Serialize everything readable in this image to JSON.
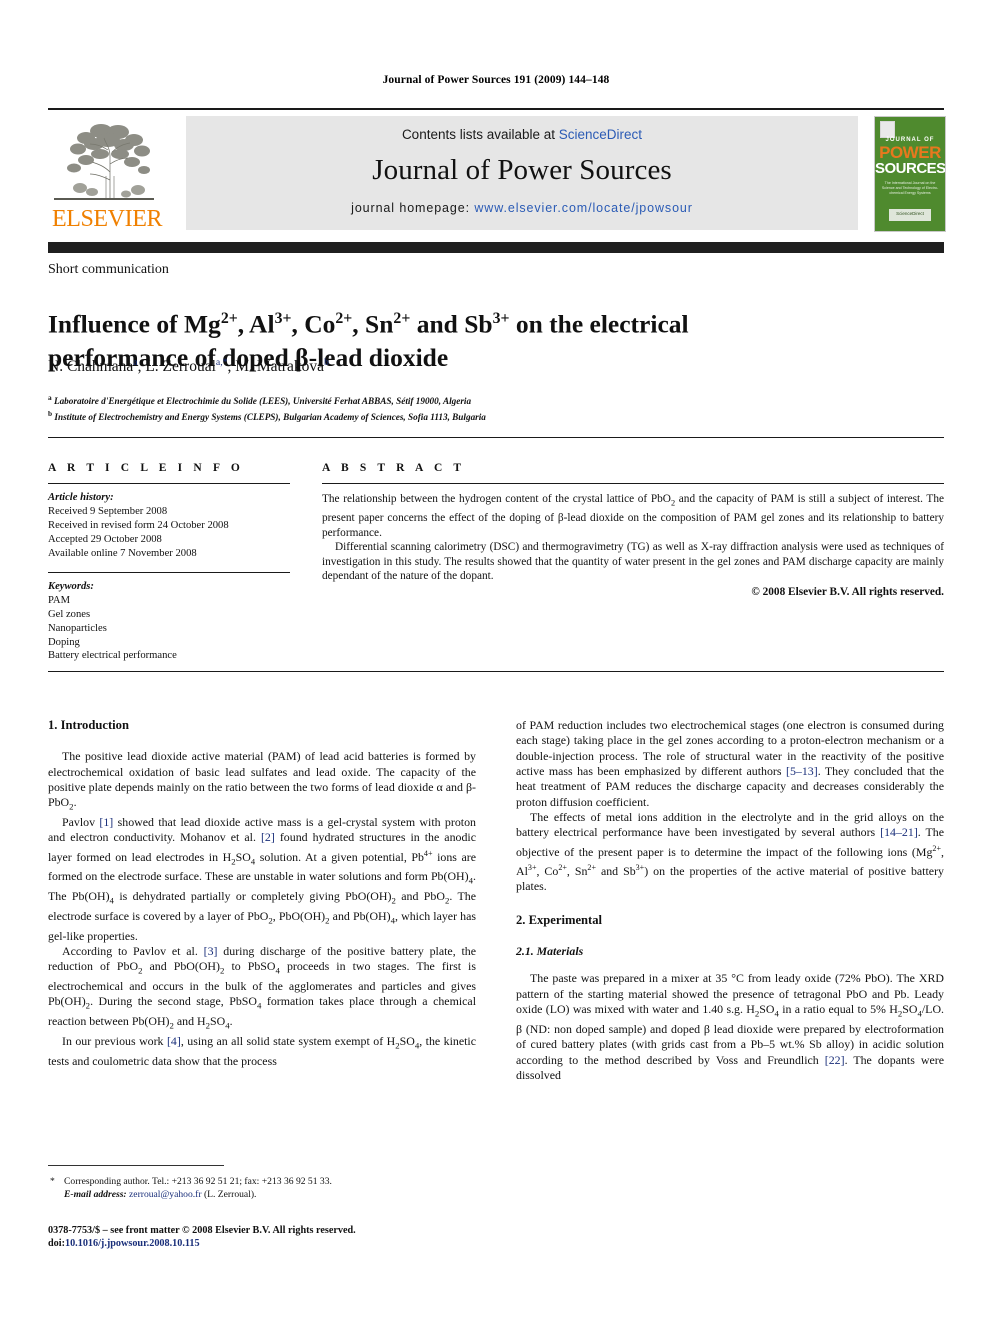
{
  "running_head": "Journal of Power Sources 191 (2009) 144–148",
  "header": {
    "contents_prefix": "Contents lists available at ",
    "sciencedirect": "ScienceDirect",
    "journal_title": "Journal of Power Sources",
    "homepage_label": "journal homepage: ",
    "homepage_url": "www.elsevier.com/locate/jpowsour",
    "publisher_logo_word": "ELSEVIER",
    "accent_orange": "#F08000",
    "link_blue": "#2b5bb5",
    "panel_gray": "#e6e6e6",
    "cover": {
      "line1": "JOURNAL OF",
      "line2": "POWER",
      "line3": "SOURCES",
      "blurb": "The International Journal on the Science and Technology of Electro­chemical Energy Systems",
      "sciencedirect_badge": "ScienceDirect",
      "bg_color": "#4f8a2e"
    }
  },
  "article": {
    "type_label": "Short communication",
    "title_html": "Influence of Mg<sup>2+</sup>, Al<sup>3+</sup>, Co<sup>2+</sup>, Sn<sup>2+</sup> and Sb<sup>3+</sup> on the electrical performance of doped β-lead dioxide",
    "authors_html": "N. Chahmana<sup>a</sup>, L. Zerroual<sup>a,*</sup>, M. Matrakova<sup>b</sup>",
    "affiliations_html": "<sup>a</sup> Laboratoire d'Energétique et Electrochimie du Solide (LEES), Université Ferhat ABBAS, Sétif 19000, Algeria<br><sup>b</sup> Institute of Electrochemistry and Energy Systems (CLEPS), Bulgarian Academy of Sciences, Sofia 1113, Bulgaria"
  },
  "info": {
    "heading": "A R T I C L E   I N F O",
    "history_label": "Article history:",
    "history": [
      "Received 9 September 2008",
      "Received in revised form 24 October 2008",
      "Accepted 29 October 2008",
      "Available online 7 November 2008"
    ],
    "keywords_label": "Keywords:",
    "keywords": [
      "PAM",
      "Gel zones",
      "Nanoparticles",
      "Doping",
      "Battery electrical performance"
    ]
  },
  "abstract": {
    "heading": "A B S T R A C T",
    "para1_html": "The relationship between the hydrogen content of the crystal lattice of PbO<sub>2</sub> and the capacity of PAM is still a subject of interest. The present paper concerns the effect of the doping of β-lead dioxide on the composition of PAM gel zones and its relationship to battery performance.",
    "para2_html": "Differential scanning calorimetry (DSC) and thermogravimetry (TG) as well as X-ray diffraction analysis were used as techniques of investigation in this study. The results showed that the quantity of water present in the gel zones and PAM discharge capacity are mainly dependant of the nature of the dopant.",
    "copyright": "© 2008 Elsevier B.V. All rights reserved."
  },
  "body": {
    "intro_heading": "1. Introduction",
    "left_p1_html": "The positive lead dioxide active material (PAM) of lead acid batteries is formed by electrochemical oxidation of basic lead sulfates and lead oxide. The capacity of the positive plate depends mainly on the ratio between the two forms of lead dioxide α and β-PbO<sub>2</sub>.",
    "left_p2_html": "Pavlov <span class=\"ref\">[1]</span> showed that lead dioxide active mass is a gel-crystal system with proton and electron conductivity. Mohanov et al. <span class=\"ref\">[2]</span> found hydrated structures in the anodic layer formed on lead electrodes in H<sub>2</sub>SO<sub>4</sub> solution. At a given potential, Pb<sup class=\"chg\">4+</sup> ions are formed on the electrode surface. These are unstable in water solutions and form Pb(OH)<sub>4</sub>. The Pb(OH)<sub>4</sub> is dehydrated partially or completely giving PbO(OH)<sub>2</sub> and PbO<sub>2</sub>. The electrode surface is covered by a layer of PbO<sub>2</sub>, PbO(OH)<sub>2</sub> and Pb(OH)<sub>4</sub>, which layer has gel-like properties.",
    "left_p3_html": "According to Pavlov et al. <span class=\"ref\">[3]</span> during discharge of the positive battery plate, the reduction of PbO<sub>2</sub> and PbO(OH)<sub>2</sub> to PbSO<sub>4</sub> proceeds in two stages. The first is electrochemical and occurs in the bulk of the agglomerates and particles and gives Pb(OH)<sub>2</sub>. During the second stage, PbSO<sub>4</sub> formation takes place through a chemical reaction between Pb(OH)<sub>2</sub> and H<sub>2</sub>SO<sub>4</sub>.",
    "left_p4_html": "In our previous work <span class=\"ref\">[4]</span>, using an all solid state system exempt of H<sub>2</sub>SO<sub>4</sub>, the kinetic tests and coulometric data show that the process",
    "right_p1_html": "of PAM reduction includes two electrochemical stages (one electron is consumed during each stage) taking place in the gel zones according to a proton-electron mechanism or a double-injection process. The role of structural water in the reactivity of the positive active mass has been emphasized by different authors <span class=\"ref\">[5–13]</span>. They concluded that the heat treatment of PAM reduces the discharge capacity and decreases considerably the proton diffusion coefficient.",
    "right_p2_html": "The effects of metal ions addition in the electrolyte and in the grid alloys on the battery electrical performance have been investigated by several authors <span class=\"ref\">[14–21]</span>. The objective of the present paper is to determine the impact of the following ions (Mg<sup class=\"chg\">2+</sup>, Al<sup class=\"chg\">3+</sup>, Co<sup class=\"chg\">2+</sup>, Sn<sup class=\"chg\">2+</sup> and Sb<sup class=\"chg\">3+</sup>) on the properties of the active material of positive battery plates.",
    "experimental_heading": "2. Experimental",
    "materials_heading": "2.1. Materials",
    "right_p3_html": "The paste was prepared in a mixer at 35 °C from leady oxide (72% PbO). The XRD pattern of the starting material showed the presence of tetragonal PbO and Pb. Leady oxide (LO) was mixed with water and 1.40 s.g. H<sub>2</sub>SO<sub>4</sub> in a ratio equal to 5% H<sub>2</sub>SO<sub>4</sub>/LO. β (ND: non doped sample) and doped β lead dioxide were prepared by electroformation of cured battery plates (with grids cast from a Pb–5 wt.% Sb alloy) in acidic solution according to the method described by Voss and Freundlich <span class=\"ref\">[22]</span>. The dopants were dissolved"
  },
  "footnotes": {
    "corresponding_html": "Corresponding author. Tel.: +213 36 92 51 21; fax: +213 36 92 51 33.",
    "email_label": "E-mail address:",
    "email": "zerroual@yahoo.fr",
    "email_owner": "(L. Zerroual).",
    "issn_line": "0378-7753/$ – see front matter © 2008 Elsevier B.V. All rights reserved.",
    "doi_label": "doi:",
    "doi": "10.1016/j.jpowsour.2008.10.115"
  }
}
